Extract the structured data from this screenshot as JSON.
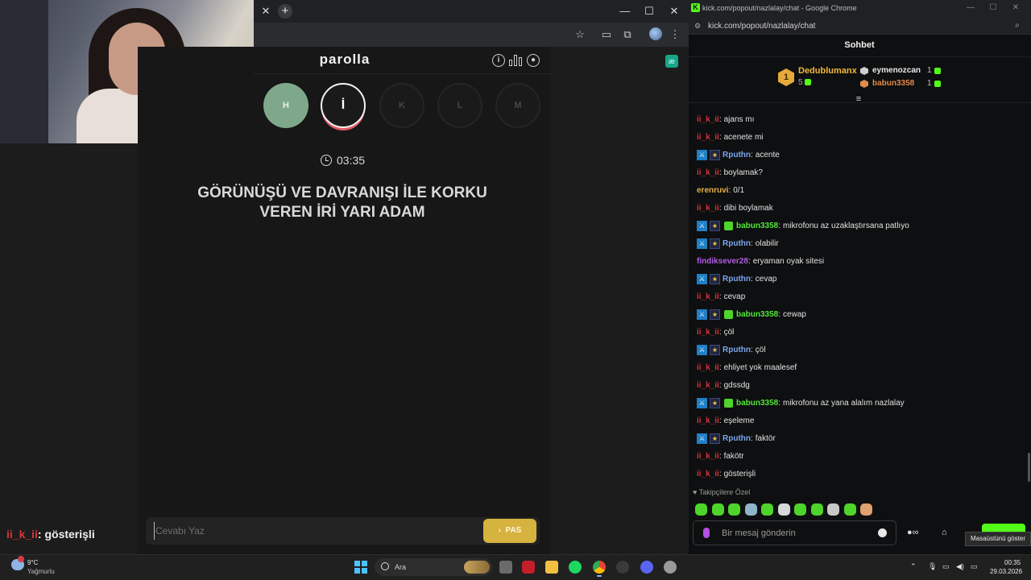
{
  "game": {
    "app_title": "parolla",
    "letters": [
      {
        "char": "H",
        "state": "done"
      },
      {
        "char": "İ",
        "state": "active"
      },
      {
        "char": "K",
        "state": "pending"
      },
      {
        "char": "L",
        "state": "pending"
      },
      {
        "char": "M",
        "state": "pending"
      }
    ],
    "timer": "03:35",
    "question_line1": "GÖRÜNÜŞÜ VE DAVRANIŞI İLE KORKU",
    "question_line2": "VEREN İRİ YARI ADAM",
    "answer_placeholder": "Cevabı Yaz",
    "pass_label": "PAS",
    "colors": {
      "done": "#7fa88a",
      "active_ring": "#f2f2f2",
      "active_accent": "#e05a64",
      "pass": "#d6b23e"
    }
  },
  "overlay": {
    "user": "ii_k_ii",
    "text": ": gösterişli"
  },
  "chat_window": {
    "title_bar": "kick.com/popout/nazlalay/chat - Google Chrome",
    "url": "kick.com/popout/nazlalay/chat",
    "header": "Sohbet",
    "leaderboard": {
      "first": {
        "rank": "1",
        "name": "Dedublumanx",
        "count": "5"
      },
      "second": {
        "name": "eymenozcan",
        "count": "1"
      },
      "third": {
        "name": "babun3358",
        "count": "1"
      }
    },
    "messages": [
      {
        "user": "ii_k_ii",
        "color": "#d0343c",
        "badges": [],
        "text": "ajans mı"
      },
      {
        "user": "ii_k_ii",
        "color": "#d0343c",
        "badges": [],
        "text": "acenete mi"
      },
      {
        "user": "Rputhn",
        "color": "#7aa6f0",
        "badges": [
          "mod",
          "star"
        ],
        "text": "acente"
      },
      {
        "user": "ii_k_ii",
        "color": "#d0343c",
        "badges": [],
        "text": "boylamak?"
      },
      {
        "user": "erenruvi",
        "color": "#e8b04a",
        "badges": [],
        "text": "0/1"
      },
      {
        "user": "ii_k_ii",
        "color": "#d0343c",
        "badges": [],
        "text": "dibi boylamak"
      },
      {
        "user": "babun3358",
        "color": "#53e63a",
        "badges": [
          "mod",
          "star",
          "gift"
        ],
        "text": "mikrofonu az uzaklaştırsana patlıyo"
      },
      {
        "user": "Rputhn",
        "color": "#7aa6f0",
        "badges": [
          "mod",
          "star"
        ],
        "text": "olabilir"
      },
      {
        "user": "findiksever28",
        "color": "#b45ce6",
        "badges": [],
        "text": "eryaman oyak sitesi"
      },
      {
        "user": "Rputhn",
        "color": "#7aa6f0",
        "badges": [
          "mod",
          "star"
        ],
        "text": "cevap"
      },
      {
        "user": "ii_k_ii",
        "color": "#d0343c",
        "badges": [],
        "text": "cevap"
      },
      {
        "user": "babun3358",
        "color": "#53e63a",
        "badges": [
          "mod",
          "star",
          "gift"
        ],
        "text": "cewap"
      },
      {
        "user": "ii_k_ii",
        "color": "#d0343c",
        "badges": [],
        "text": "çöl"
      },
      {
        "user": "Rputhn",
        "color": "#7aa6f0",
        "badges": [
          "mod",
          "star"
        ],
        "text": "çöl"
      },
      {
        "user": "ii_k_ii",
        "color": "#d0343c",
        "badges": [],
        "text": "ehliyet yok maalesef"
      },
      {
        "user": "ii_k_ii",
        "color": "#d0343c",
        "badges": [],
        "text": "gdssdg"
      },
      {
        "user": "babun3358",
        "color": "#53e63a",
        "badges": [
          "mod",
          "star",
          "gift"
        ],
        "text": "mikrofonu az yana alalım nazlalay"
      },
      {
        "user": "ii_k_ii",
        "color": "#d0343c",
        "badges": [],
        "text": "eşeleme"
      },
      {
        "user": "Rputhn",
        "color": "#7aa6f0",
        "badges": [
          "mod",
          "star"
        ],
        "text": "faktör"
      },
      {
        "user": "ii_k_ii",
        "color": "#d0343c",
        "badges": [],
        "text": "fakötr"
      },
      {
        "user": "ii_k_ii",
        "color": "#d0343c",
        "badges": [],
        "text": "gösterişli"
      }
    ],
    "followers_only": "Takipçilere Özel",
    "emote_colors": [
      "#4ed42a",
      "#4ed42a",
      "#4ed42a",
      "#8fb6c8",
      "#4ed42a",
      "#d8d8d8",
      "#4ed42a",
      "#4ed42a",
      "#c8c8c8",
      "#4ed42a",
      "#e0a070"
    ],
    "input_placeholder": "Bir mesaj gönderin",
    "tooltip": "Masaüstünü göster"
  },
  "taskbar": {
    "temp": "9°C",
    "weather": "Yağmurlu",
    "search_placeholder": "Ara",
    "time": "00:35",
    "date": "29.03.2026"
  }
}
